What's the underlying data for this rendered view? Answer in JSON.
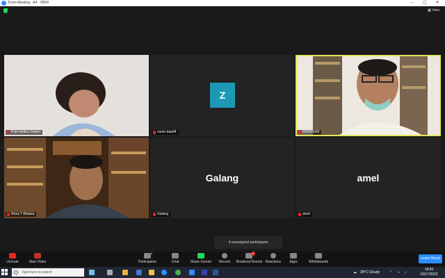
{
  "window": {
    "title": "Zoom Meeting - A4 - VB04"
  },
  "header": {
    "view_label": "View"
  },
  "tiles": {
    "putri": "Putri Andira Drakel",
    "zoom": "zoom baa04",
    "zoom_initial": "Z",
    "fatkhur": "FATKHURI",
    "resa": "Resa T Bintara",
    "galang": "Galang",
    "amel": "amel"
  },
  "toast": "4 unassigned participants",
  "toolbar": {
    "unmute": "Unmute",
    "start_video": "Start Video",
    "participants": "Participants",
    "participants_count": "8",
    "chat": "Chat",
    "share_screen": "Share Screen",
    "record": "Record",
    "breakout": "Breakout Rooms",
    "breakout_badge": "4",
    "reactions": "Reactions",
    "apps": "Apps",
    "whiteboards": "Whiteboards",
    "leave": "Leave Room"
  },
  "taskbar": {
    "search_placeholder": "Type here to search",
    "weather": "28°C  Cloudy",
    "time": "18:50",
    "date": "10/17/2022"
  },
  "colors": {
    "accent": "#2d8cff",
    "active_border": "#e4e85a",
    "avatar_bg": "#1d99b6",
    "muted": "#e02828"
  }
}
